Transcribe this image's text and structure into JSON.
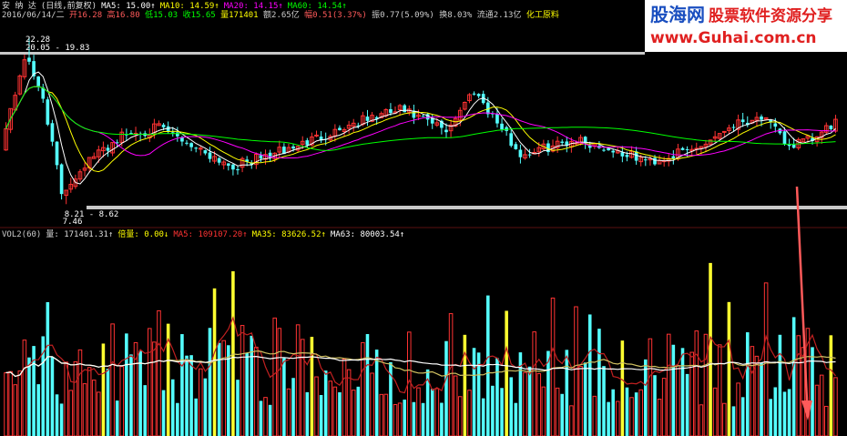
{
  "header": {
    "stock_name": "安 纳 达",
    "period": "(日线,前复权)",
    "ma5_label": "MA5:",
    "ma5_value": "15.00↑",
    "ma10_label": "MA10:",
    "ma10_value": "14.59↑",
    "ma20_label": "MA20:",
    "ma20_value": "14.15↑",
    "ma60_label": "MA60:",
    "ma60_value": "14.54↑",
    "date": "2016/06/14/二",
    "open": "开16.28",
    "high": "高16.80",
    "low": "低15.03",
    "close": "收15.65",
    "volume": "量171401",
    "amount": "额2.65亿",
    "change_pct": "幅0.51(3.37%)",
    "amplitude": "振0.77(5.09%)",
    "turnover": "换8.03%",
    "float_cap": "流通2.13亿",
    "sector": "化工原料"
  },
  "volume_header": {
    "title": "VOL2(60)",
    "vol_label": "量:",
    "vol_value": "171401.31↑",
    "multiple_label": "倍量:",
    "multiple_value": "0.00↓",
    "ma5_label": "MA5:",
    "ma5_value": "109107.20↑",
    "ma35_label": "MA35:",
    "ma35_value": "83626.52↑",
    "ma63_label": "MA63:",
    "ma63_value": "80003.54↑"
  },
  "annotations": {
    "high_price": "22.28",
    "high_range": "20.05 - 19.83",
    "low_range": "8.21 - 8.62",
    "low_price": "7.46"
  },
  "watermark": {
    "line1_a": "股海网",
    "line1_b": "股票软件资源分享",
    "line2": "www.Guhai.com.cn"
  },
  "colors": {
    "up": "#ff3333",
    "down": "#54ffff",
    "ma5": "#ffffff",
    "ma10": "#ffff00",
    "ma20": "#ff00ff",
    "ma60": "#00ff00",
    "vol_ma_white": "#ffffff",
    "vol_ma_red": "#c02020",
    "highlight": "#ffff30",
    "accent_red": "#ff5a5a",
    "separator": "#c8c8c8",
    "wm_blue": "#1a4fc0",
    "wm_red": "#e02020"
  },
  "chart_data": {
    "type": "candlestick",
    "price_axis_range": [
      7.0,
      23.5
    ],
    "peak_index": 5,
    "trough_index": 13,
    "ma_series": [
      "MA5",
      "MA10",
      "MA20",
      "MA60"
    ],
    "volume_series": [
      "VOL",
      "MA5",
      "MA35",
      "MA63"
    ]
  }
}
